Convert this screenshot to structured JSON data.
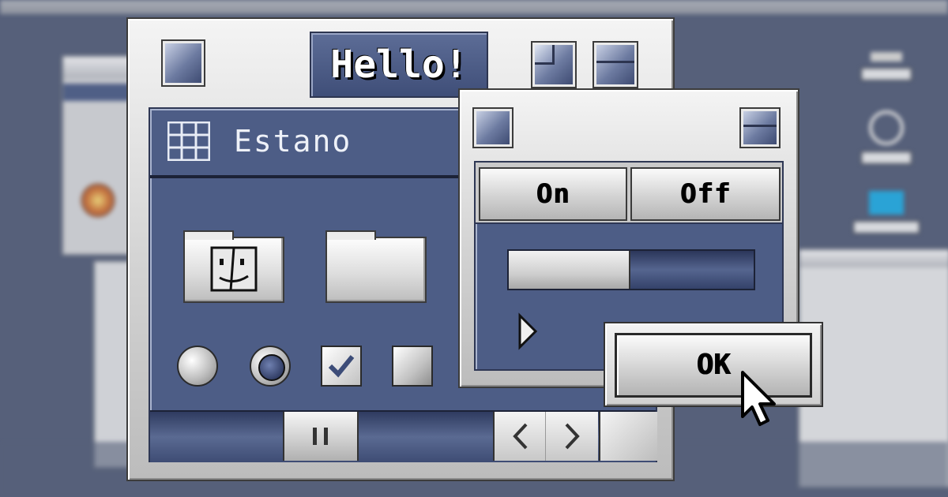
{
  "main_window": {
    "title": "Hello!",
    "folder_header": "Estano"
  },
  "dialog": {
    "tabs": [
      {
        "label": "On",
        "selected": true
      },
      {
        "label": "Off",
        "selected": false
      }
    ],
    "progress": 0.49,
    "ok_label": "OK"
  },
  "controls": {
    "radio_1_selected": false,
    "radio_2_selected": true,
    "checkbox_1_checked": true,
    "checkbox_2_checked": false
  },
  "colors": {
    "accent_blue": "#4d5d86",
    "chrome_light": "#f4f4f4",
    "chrome_dark": "#3c3c3c"
  },
  "icons": [
    "finder-icon",
    "folder-icon",
    "grid-icon",
    "cursor-icon",
    "disclosure-triangle-icon",
    "scroll-left-icon",
    "scroll-right-icon"
  ]
}
